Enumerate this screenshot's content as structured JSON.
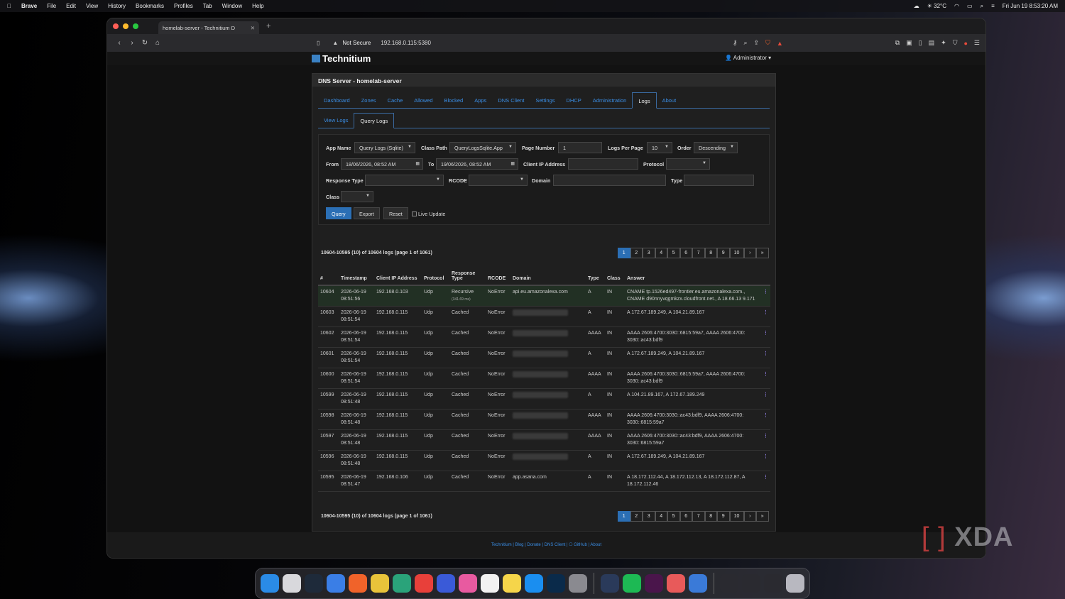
{
  "menubar": {
    "app": "Brave",
    "items": [
      "File",
      "Edit",
      "View",
      "History",
      "Bookmarks",
      "Profiles",
      "Tab",
      "Window",
      "Help"
    ],
    "weather": "☀ 32°C",
    "clock": "Fri Jun 19  8:53:20 AM"
  },
  "browser": {
    "tab_title": "homelab-server - Technitium D",
    "not_secure": "Not Secure",
    "url": "192.168.0.115:5380"
  },
  "app": {
    "logo": "Technitium",
    "user": "Administrator",
    "panel_title": "DNS Server - homelab-server"
  },
  "nav_tabs": [
    "Dashboard",
    "Zones",
    "Cache",
    "Allowed",
    "Blocked",
    "Apps",
    "DNS Client",
    "Settings",
    "DHCP",
    "Administration",
    "Logs",
    "About"
  ],
  "sub_tabs": [
    "View Logs",
    "Query Logs"
  ],
  "form": {
    "app_name_label": "App Name",
    "app_name": "Query Logs (Sqlite)",
    "class_path_label": "Class Path",
    "class_path": "QueryLogsSqlite.App",
    "page_number_label": "Page Number",
    "page_number": "1",
    "logs_per_page_label": "Logs Per Page",
    "logs_per_page": "10",
    "order_label": "Order",
    "order": "Descending",
    "from_label": "From",
    "from": "18/06/2026, 08:52 AM",
    "to_label": "To",
    "to": "19/06/2026, 08:52 AM",
    "client_ip_label": "Client IP Address",
    "client_ip": "",
    "protocol_label": "Protocol",
    "protocol": "",
    "response_type_label": "Response Type",
    "response_type": "",
    "rcode_label": "RCODE",
    "rcode": "",
    "domain_label": "Domain",
    "domain": "",
    "type_label": "Type",
    "type": "",
    "class_label": "Class",
    "class": "",
    "query_btn": "Query",
    "export_btn": "Export",
    "reset_btn": "Reset",
    "live_update": "Live Update"
  },
  "summary": "10604-10595 (10) of 10604 logs (page 1 of 1061)",
  "pagination": [
    "1",
    "2",
    "3",
    "4",
    "5",
    "6",
    "7",
    "8",
    "9",
    "10",
    "›",
    "»"
  ],
  "table": {
    "headers": [
      "#",
      "Timestamp",
      "Client IP Address",
      "Protocol",
      "Response Type",
      "RCODE",
      "Domain",
      "Type",
      "Class",
      "Answer"
    ],
    "rows": [
      {
        "id": "10604",
        "ts": "2026-06-19 08:51:56",
        "ip": "192.168.0.103",
        "proto": "Udp",
        "resp": "Recursive",
        "resp_time": "(341.69 ms)",
        "rcode": "NoError",
        "domain": "api.eu.amazonalexa.com",
        "type": "A",
        "class": "IN",
        "answer": "CNAME tp.1526ed497-frontier.eu.amazonalexa.com., CNAME d90nnyvqgmkzx.cloudfront.net., A 18.66.13 9.171"
      },
      {
        "id": "10603",
        "ts": "2026-06-19 08:51:54",
        "ip": "192.168.0.115",
        "proto": "Udp",
        "resp": "Cached",
        "resp_time": "",
        "rcode": "NoError",
        "domain": "",
        "type": "A",
        "class": "IN",
        "answer": "A 172.67.189.249, A 104.21.89.167"
      },
      {
        "id": "10602",
        "ts": "2026-06-19 08:51:54",
        "ip": "192.168.0.115",
        "proto": "Udp",
        "resp": "Cached",
        "resp_time": "",
        "rcode": "NoError",
        "domain": "",
        "type": "AAAA",
        "class": "IN",
        "answer": "AAAA 2606:4700:3030::6815:59a7, AAAA 2606:4700: 3030::ac43:bdf9"
      },
      {
        "id": "10601",
        "ts": "2026-06-19 08:51:54",
        "ip": "192.168.0.115",
        "proto": "Udp",
        "resp": "Cached",
        "resp_time": "",
        "rcode": "NoError",
        "domain": "",
        "type": "A",
        "class": "IN",
        "answer": "A 172.67.189.249, A 104.21.89.167"
      },
      {
        "id": "10600",
        "ts": "2026-06-19 08:51:54",
        "ip": "192.168.0.115",
        "proto": "Udp",
        "resp": "Cached",
        "resp_time": "",
        "rcode": "NoError",
        "domain": "",
        "type": "AAAA",
        "class": "IN",
        "answer": "AAAA 2606:4700:3030::6815:59a7, AAAA 2606:4700: 3030::ac43:bdf9"
      },
      {
        "id": "10599",
        "ts": "2026-06-19 08:51:48",
        "ip": "192.168.0.115",
        "proto": "Udp",
        "resp": "Cached",
        "resp_time": "",
        "rcode": "NoError",
        "domain": "",
        "type": "A",
        "class": "IN",
        "answer": "A 104.21.89.167, A 172.67.189.249"
      },
      {
        "id": "10598",
        "ts": "2026-06-19 08:51:48",
        "ip": "192.168.0.115",
        "proto": "Udp",
        "resp": "Cached",
        "resp_time": "",
        "rcode": "NoError",
        "domain": "",
        "type": "AAAA",
        "class": "IN",
        "answer": "AAAA 2606:4700:3030::ac43:bdf9, AAAA 2606:4700: 3030::6815:59a7"
      },
      {
        "id": "10597",
        "ts": "2026-06-19 08:51:48",
        "ip": "192.168.0.115",
        "proto": "Udp",
        "resp": "Cached",
        "resp_time": "",
        "rcode": "NoError",
        "domain": "",
        "type": "AAAA",
        "class": "IN",
        "answer": "AAAA 2606:4700:3030::ac43:bdf9, AAAA 2606:4700: 3030::6815:59a7"
      },
      {
        "id": "10596",
        "ts": "2026-06-19 08:51:48",
        "ip": "192.168.0.115",
        "proto": "Udp",
        "resp": "Cached",
        "resp_time": "",
        "rcode": "NoError",
        "domain": "",
        "type": "A",
        "class": "IN",
        "answer": "A 172.67.189.249, A 104.21.89.167"
      },
      {
        "id": "10595",
        "ts": "2026-06-19 08:51:47",
        "ip": "192.168.0.106",
        "proto": "Udp",
        "resp": "Cached",
        "resp_time": "",
        "rcode": "NoError",
        "domain": "app.asana.com",
        "type": "A",
        "class": "IN",
        "answer": "A 18.172.112.44, A 18.172.112.13, A 18.172.112.87, A 18.172.112.46"
      }
    ]
  },
  "footer": "Technitium | Blog | Donate | DNS Client | ⎔ GitHub | About",
  "watermark": "XDA",
  "colors": {
    "accent": "#2b6fb5",
    "link": "#3a8ee6",
    "highlight_row": "#223024"
  }
}
